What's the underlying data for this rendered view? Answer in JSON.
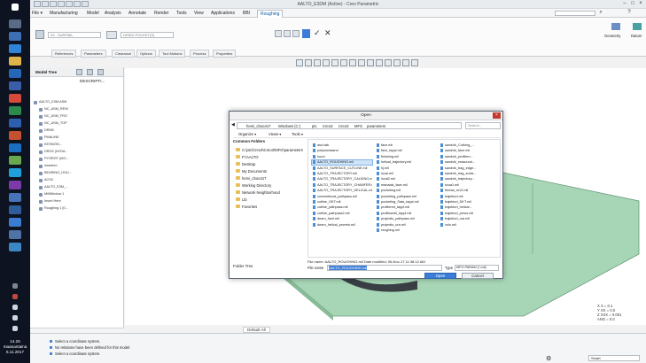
{
  "app": {
    "title": "AALTO_E3DM (Active) - Creo Parametric",
    "colors": {
      "accent": "#0b57a4",
      "taskbar": "#0d1320",
      "part_green": "#a7d6b6"
    }
  },
  "taskbar": {
    "clock_time": "14.26",
    "clock_day": "maanantaina",
    "clock_date": "6.11.2017"
  },
  "menubar": {
    "items": [
      "File ▾",
      "Manufacturing",
      "Model",
      "Analysis",
      "Annotate",
      "Render",
      "Tools",
      "View",
      "Applications",
      "BBI",
      "Roughing"
    ],
    "active": "Roughing"
  },
  "ribbon": {
    "mill_field": "03 - SURFMIL",
    "ref_field": "DRIED POCKET(S)",
    "tabs": [
      "References",
      "Parameters",
      "Clearance",
      "Options",
      "Tool Motions",
      "Process",
      "Properties"
    ],
    "right_tools": [
      "Geometry",
      "Datum"
    ]
  },
  "tree": {
    "title": "Model Tree",
    "column": "DESCRIPTI...",
    "rows": [
      "AALTO_E3M.ASM",
      "NC_ASM_REW",
      "NC_ASM_FRO",
      "NC_ASM_TOP",
      "DRM0",
      "PMALINE",
      "KESKIÖN...",
      "DRO3 (NYDA...",
      "PYÖRÖT (MO...",
      "insertnm",
      "BEARING_HOU...",
      "ACS0",
      "AALTO_E3M_...",
      "MillWindow 1",
      "Insert Here",
      "Roughing 1 [0..."
    ]
  },
  "viewport": {
    "default_all": "Default All",
    "coords": [
      "X X = 0.1",
      "Y XX = 0.0",
      "Z XXX = 0.001",
      "ANG = 0.0"
    ]
  },
  "status": {
    "messages": [
      "Select a coordinate system.",
      "No relations have been defined for this model.",
      "Select a coordinate system."
    ],
    "filter": "Smart"
  },
  "dialog": {
    "title": "Open",
    "breadcrumbs": [
      "hemi_cboo417",
      "Windows (C:)",
      "ptc",
      "Creo3",
      "Creo3",
      "MFG",
      "parameters"
    ],
    "search_placeholder": "Search...",
    "toolbar": [
      "Organize ▾",
      "Views ▾",
      "Tools ▾"
    ],
    "common_folders_title": "Common Folders",
    "common_folders": [
      "C:\\ptc\\Creo3\\Creo3\\MFG\\parameters",
      "P:\\AALTO",
      "Desktop",
      "My Documents",
      "hemi_cboo417",
      "Working Directory",
      "Network Neighborhood",
      "Lib",
      "Favorites"
    ],
    "folder_tree_label": "Folder Tree",
    "files": [
      [
        "ascl.tab",
        "polynomiaand",
        "kucci",
        "AALTO_ROUGHING.mil",
        "AALTO_SURFACE_CUTLINE.mil",
        "AALTO_TRAJECTORY.mil",
        "AALTO_TRAJECTORY_CALKING.mil",
        "AALTO_TRAJECTORY_CHAMFER.mil",
        "AALTO_TRAJECTORY_HELICAL.mil",
        "conventional_pathpass.mil",
        "cutline_OKT.mil",
        "cutline_pathpass.mil",
        "cutline_pathpass2.mil",
        "dearo_hwd.mil",
        "dearo_helical_proreta.mil"
      ],
      [
        "face.mil",
        "face_tappi.mil",
        "finishing.mil",
        "helical_trajectory.mil",
        "hj.mil",
        "local.mil",
        "local2.mil",
        "manaasi_face.mil",
        "pocketing.mil",
        "pocketing_pathpass.mil",
        "pocketing_Sata_tappi.mil",
        "profilered_tappi.mil",
        "profilesmill_tappi.mil",
        "projectis_pathpass.mil",
        "projectis_ura.mil",
        "roughing.mil"
      ],
      [
        "sandvik_Cuthing_...",
        "sandvik_face.mil",
        "sandvik_profilem...",
        "sandvik_reasound...",
        "sandvik_trag_edge...",
        "sandvik_trag_surfa...",
        "sandvik_trajectory...",
        "scua1.mil",
        "thread_m12.mil",
        "trajektori.mil",
        "trajektori_DKT.mil",
        "trajektori_helical...",
        "trajektori_perus.mil",
        "trajektori_ura.mil",
        "volo.mil"
      ]
    ],
    "selected_file": "AALTO_ROUGHING.mil",
    "file_info": "File name: AALTO_ROUGHING.mil   Date modified: 06-Nov-17 11:38:12 AM",
    "file_name_label": "File name",
    "file_name_value": "AALTO_ROUGHING.mil",
    "type_label": "Type",
    "type_value": "MFG PARAM (*.mil)",
    "open_label": "Open",
    "cancel_label": "Cancel"
  }
}
